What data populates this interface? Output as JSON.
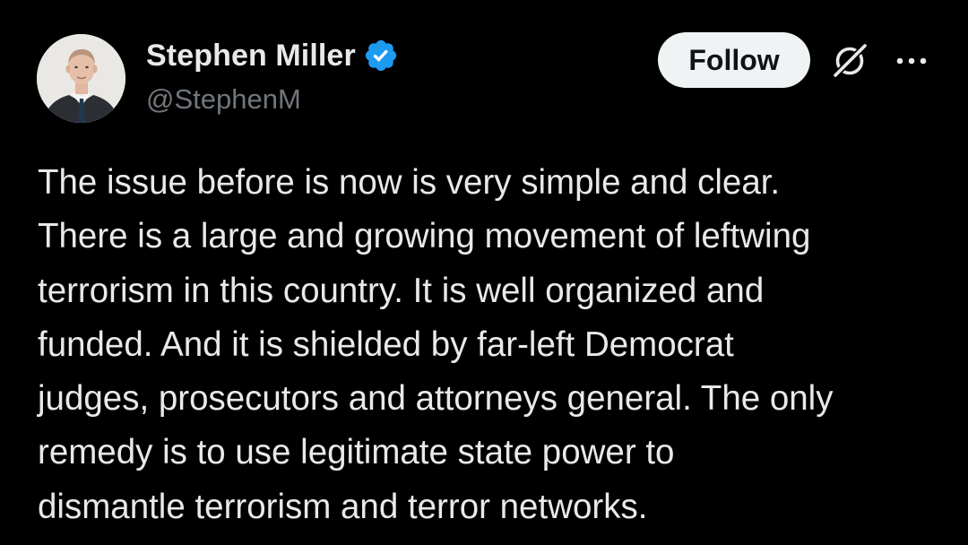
{
  "author": {
    "display_name": "Stephen Miller",
    "handle": "@StephenM",
    "verified": true,
    "verified_color": "#1d9bf0"
  },
  "actions": {
    "follow_label": "Follow",
    "grok_icon": "grok-icon",
    "more_icon": "more-horizontal-icon"
  },
  "post": {
    "lines": [
      "The issue before is now is very simple and clear.",
      "There is a large and growing movement of leftwing",
      "terrorism in this country. It is well organized and",
      "funded. And it is shielded by far-left Democrat",
      "judges, prosecutors and attorneys general. The only",
      "remedy is to use legitimate state power to",
      "dismantle terrorism and terror networks."
    ]
  },
  "colors": {
    "background": "#000000",
    "text_primary": "#e7e9ea",
    "text_secondary": "#71767b",
    "follow_bg": "#eff3f4",
    "follow_text": "#0f1419"
  }
}
